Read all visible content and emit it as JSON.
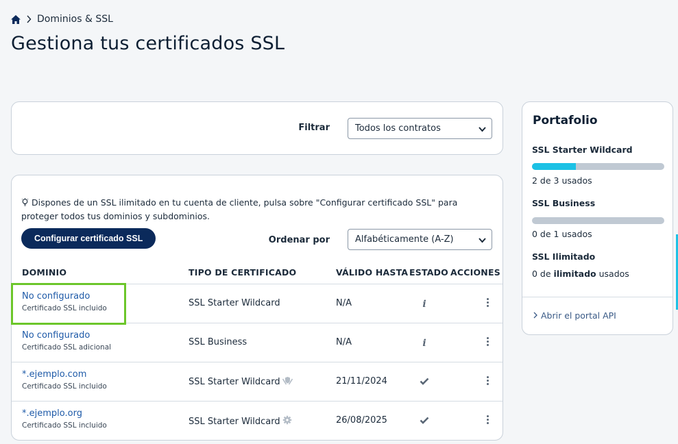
{
  "breadcrumb": {
    "section": "Dominios & SSL"
  },
  "page_title": "Gestiona tus certificados SSL",
  "filter": {
    "label": "Filtrar",
    "selected": "Todos los contratos"
  },
  "info": {
    "text": "Dispones de un SSL ilimitado en tu cuenta de cliente, pulsa sobre \"Configurar certificado SSL\" para proteger todos tus dominios y subdominios.",
    "button": "Configurar certificado SSL"
  },
  "sort": {
    "label": "Ordenar por",
    "selected": "Alfabéticamente (A-Z)"
  },
  "table": {
    "headers": [
      "DOMINIO",
      "TIPO DE CERTIFICADO",
      "VÁLIDO HASTA",
      "ESTADO",
      "ACCIONES"
    ],
    "rows": [
      {
        "domain": "No configurado",
        "note": "Certificado SSL incluido",
        "type": "SSL Starter Wildcard",
        "type_icon": "",
        "valid": "N/A",
        "state": "info-icon"
      },
      {
        "domain": "No configurado",
        "note": "Certificado SSL adicional",
        "type": "SSL Business",
        "type_icon": "",
        "valid": "N/A",
        "state": "info-icon"
      },
      {
        "domain": "*.ejemplo.com",
        "note": "Certificado SSL incluido",
        "type": "SSL Starter Wildcard",
        "type_icon": "shield-hands-icon",
        "valid": "21/11/2024",
        "state": "check-icon"
      },
      {
        "domain": "*.ejemplo.org",
        "note": "Certificado SSL incluido",
        "type": "SSL Starter Wildcard",
        "type_icon": "gear-icon",
        "valid": "26/08/2025",
        "state": "check-icon"
      }
    ]
  },
  "portfolio": {
    "title": "Portafolio",
    "items": [
      {
        "name": "SSL Starter Wildcard",
        "usage": "2 de 3 usados",
        "fraction": 0.333
      },
      {
        "name": "SSL Business",
        "usage": "0 de 1 usados",
        "fraction": 0
      }
    ],
    "unlimited": {
      "name": "SSL Ilimitado",
      "usage_prefix": "0 de ",
      "usage_bold": "ilimitado",
      "usage_suffix": " usados"
    },
    "api_link": "Abrir el portal API"
  },
  "colors": {
    "accent": "#1cc1e5",
    "button": "#0b2a5b",
    "link": "#1e5aa8",
    "highlight": "#6cc62a"
  }
}
